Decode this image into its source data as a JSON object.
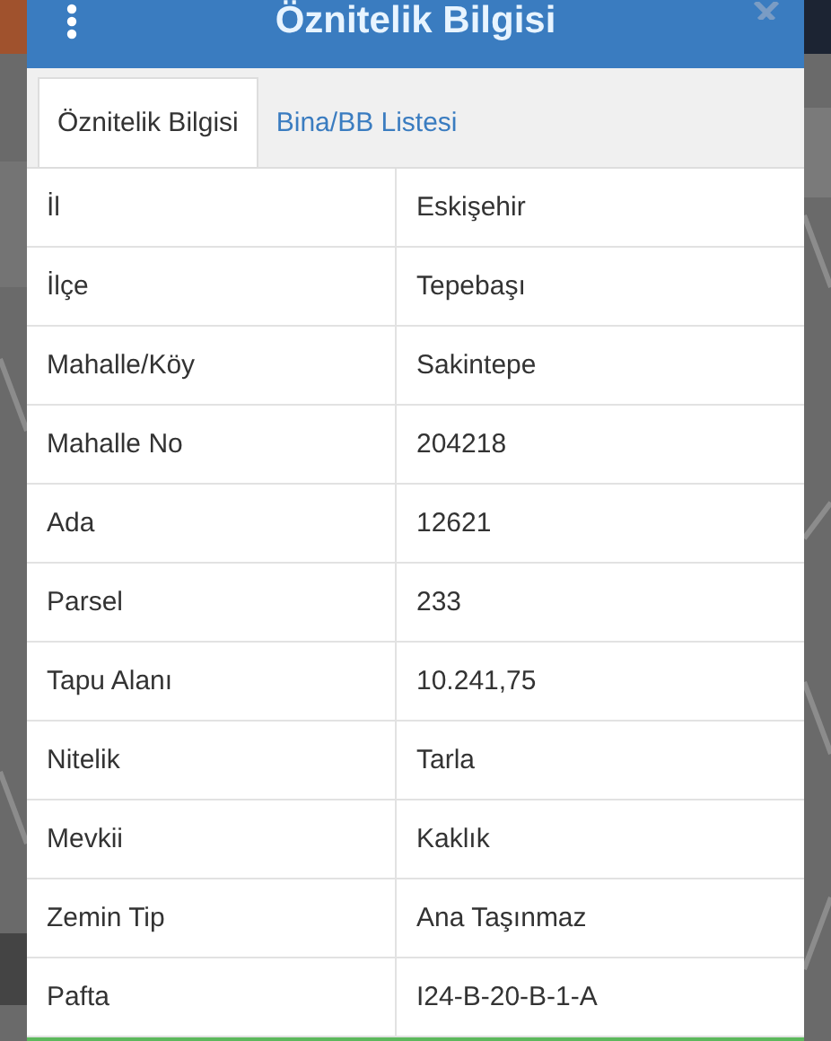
{
  "dialog": {
    "title": "Öznitelik Bilgisi"
  },
  "tabs": [
    {
      "label": "Öznitelik Bilgisi",
      "selected": true
    },
    {
      "label": "Bina/BB Listesi",
      "selected": false
    }
  ],
  "rows": [
    {
      "label": "İl",
      "value": "Eskişehir"
    },
    {
      "label": "İlçe",
      "value": "Tepebaşı"
    },
    {
      "label": "Mahalle/Köy",
      "value": "Sakintepe"
    },
    {
      "label": "Mahalle No",
      "value": "204218"
    },
    {
      "label": "Ada",
      "value": "12621"
    },
    {
      "label": "Parsel",
      "value": "233"
    },
    {
      "label": "Tapu Alanı",
      "value": "10.241,75"
    },
    {
      "label": "Nitelik",
      "value": "Tarla"
    },
    {
      "label": "Mevkii",
      "value": "Kaklık"
    },
    {
      "label": "Zemin Tip",
      "value": "Ana Taşınmaz"
    },
    {
      "label": "Pafta",
      "value": "I24-B-20-B-1-A"
    }
  ]
}
